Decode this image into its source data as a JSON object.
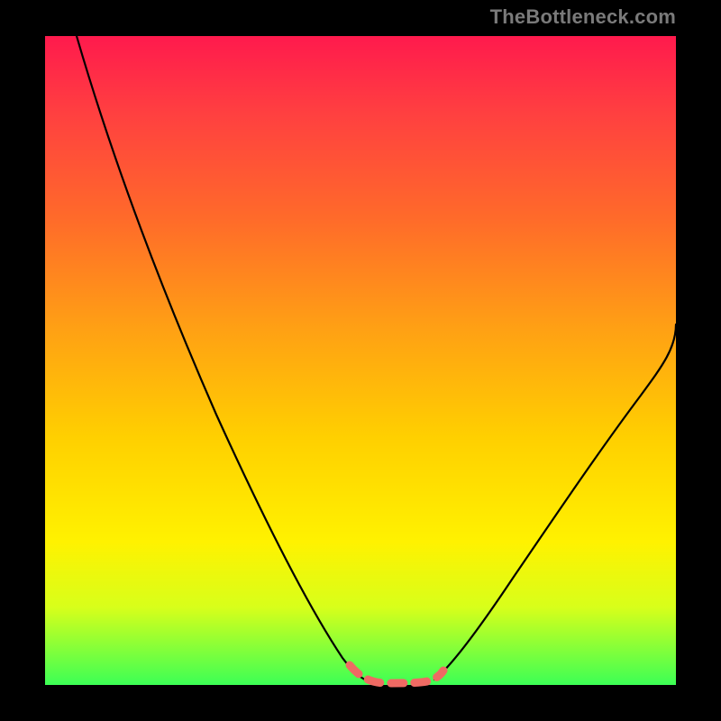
{
  "watermark": {
    "text": "TheBottleneck.com"
  },
  "chart_data": {
    "type": "line",
    "title": "",
    "xlabel": "",
    "ylabel": "",
    "xlim": [
      0,
      100
    ],
    "ylim": [
      0,
      100
    ],
    "grid": false,
    "legend": false,
    "background_gradient": [
      "#ff1a4d",
      "#ffa014",
      "#fff200",
      "#3cff55"
    ],
    "series": [
      {
        "name": "bottleneck-curve-left",
        "color": "#000000",
        "x": [
          5,
          10,
          15,
          20,
          25,
          30,
          35,
          40,
          45,
          48,
          50
        ],
        "y": [
          100,
          89,
          78,
          67,
          56,
          45,
          34,
          22,
          10,
          4,
          1
        ]
      },
      {
        "name": "bottleneck-curve-right",
        "color": "#000000",
        "x": [
          62,
          65,
          70,
          75,
          80,
          85,
          90,
          95,
          100
        ],
        "y": [
          1,
          4,
          12,
          20,
          28,
          36,
          44,
          51,
          58
        ]
      },
      {
        "name": "optimal-band",
        "color": "#ef6a63",
        "style": "dashed",
        "x": [
          48,
          50,
          52,
          54,
          56,
          58,
          60,
          62
        ],
        "y": [
          4,
          1,
          0.5,
          0.5,
          0.5,
          0.5,
          1,
          3
        ]
      }
    ],
    "notes": "V-shaped bottleneck curve over a red-to-green vertical gradient. Minimum (optimal zone) roughly between x≈48 and x≈62 near y≈0, highlighted with a coral dashed segment."
  }
}
